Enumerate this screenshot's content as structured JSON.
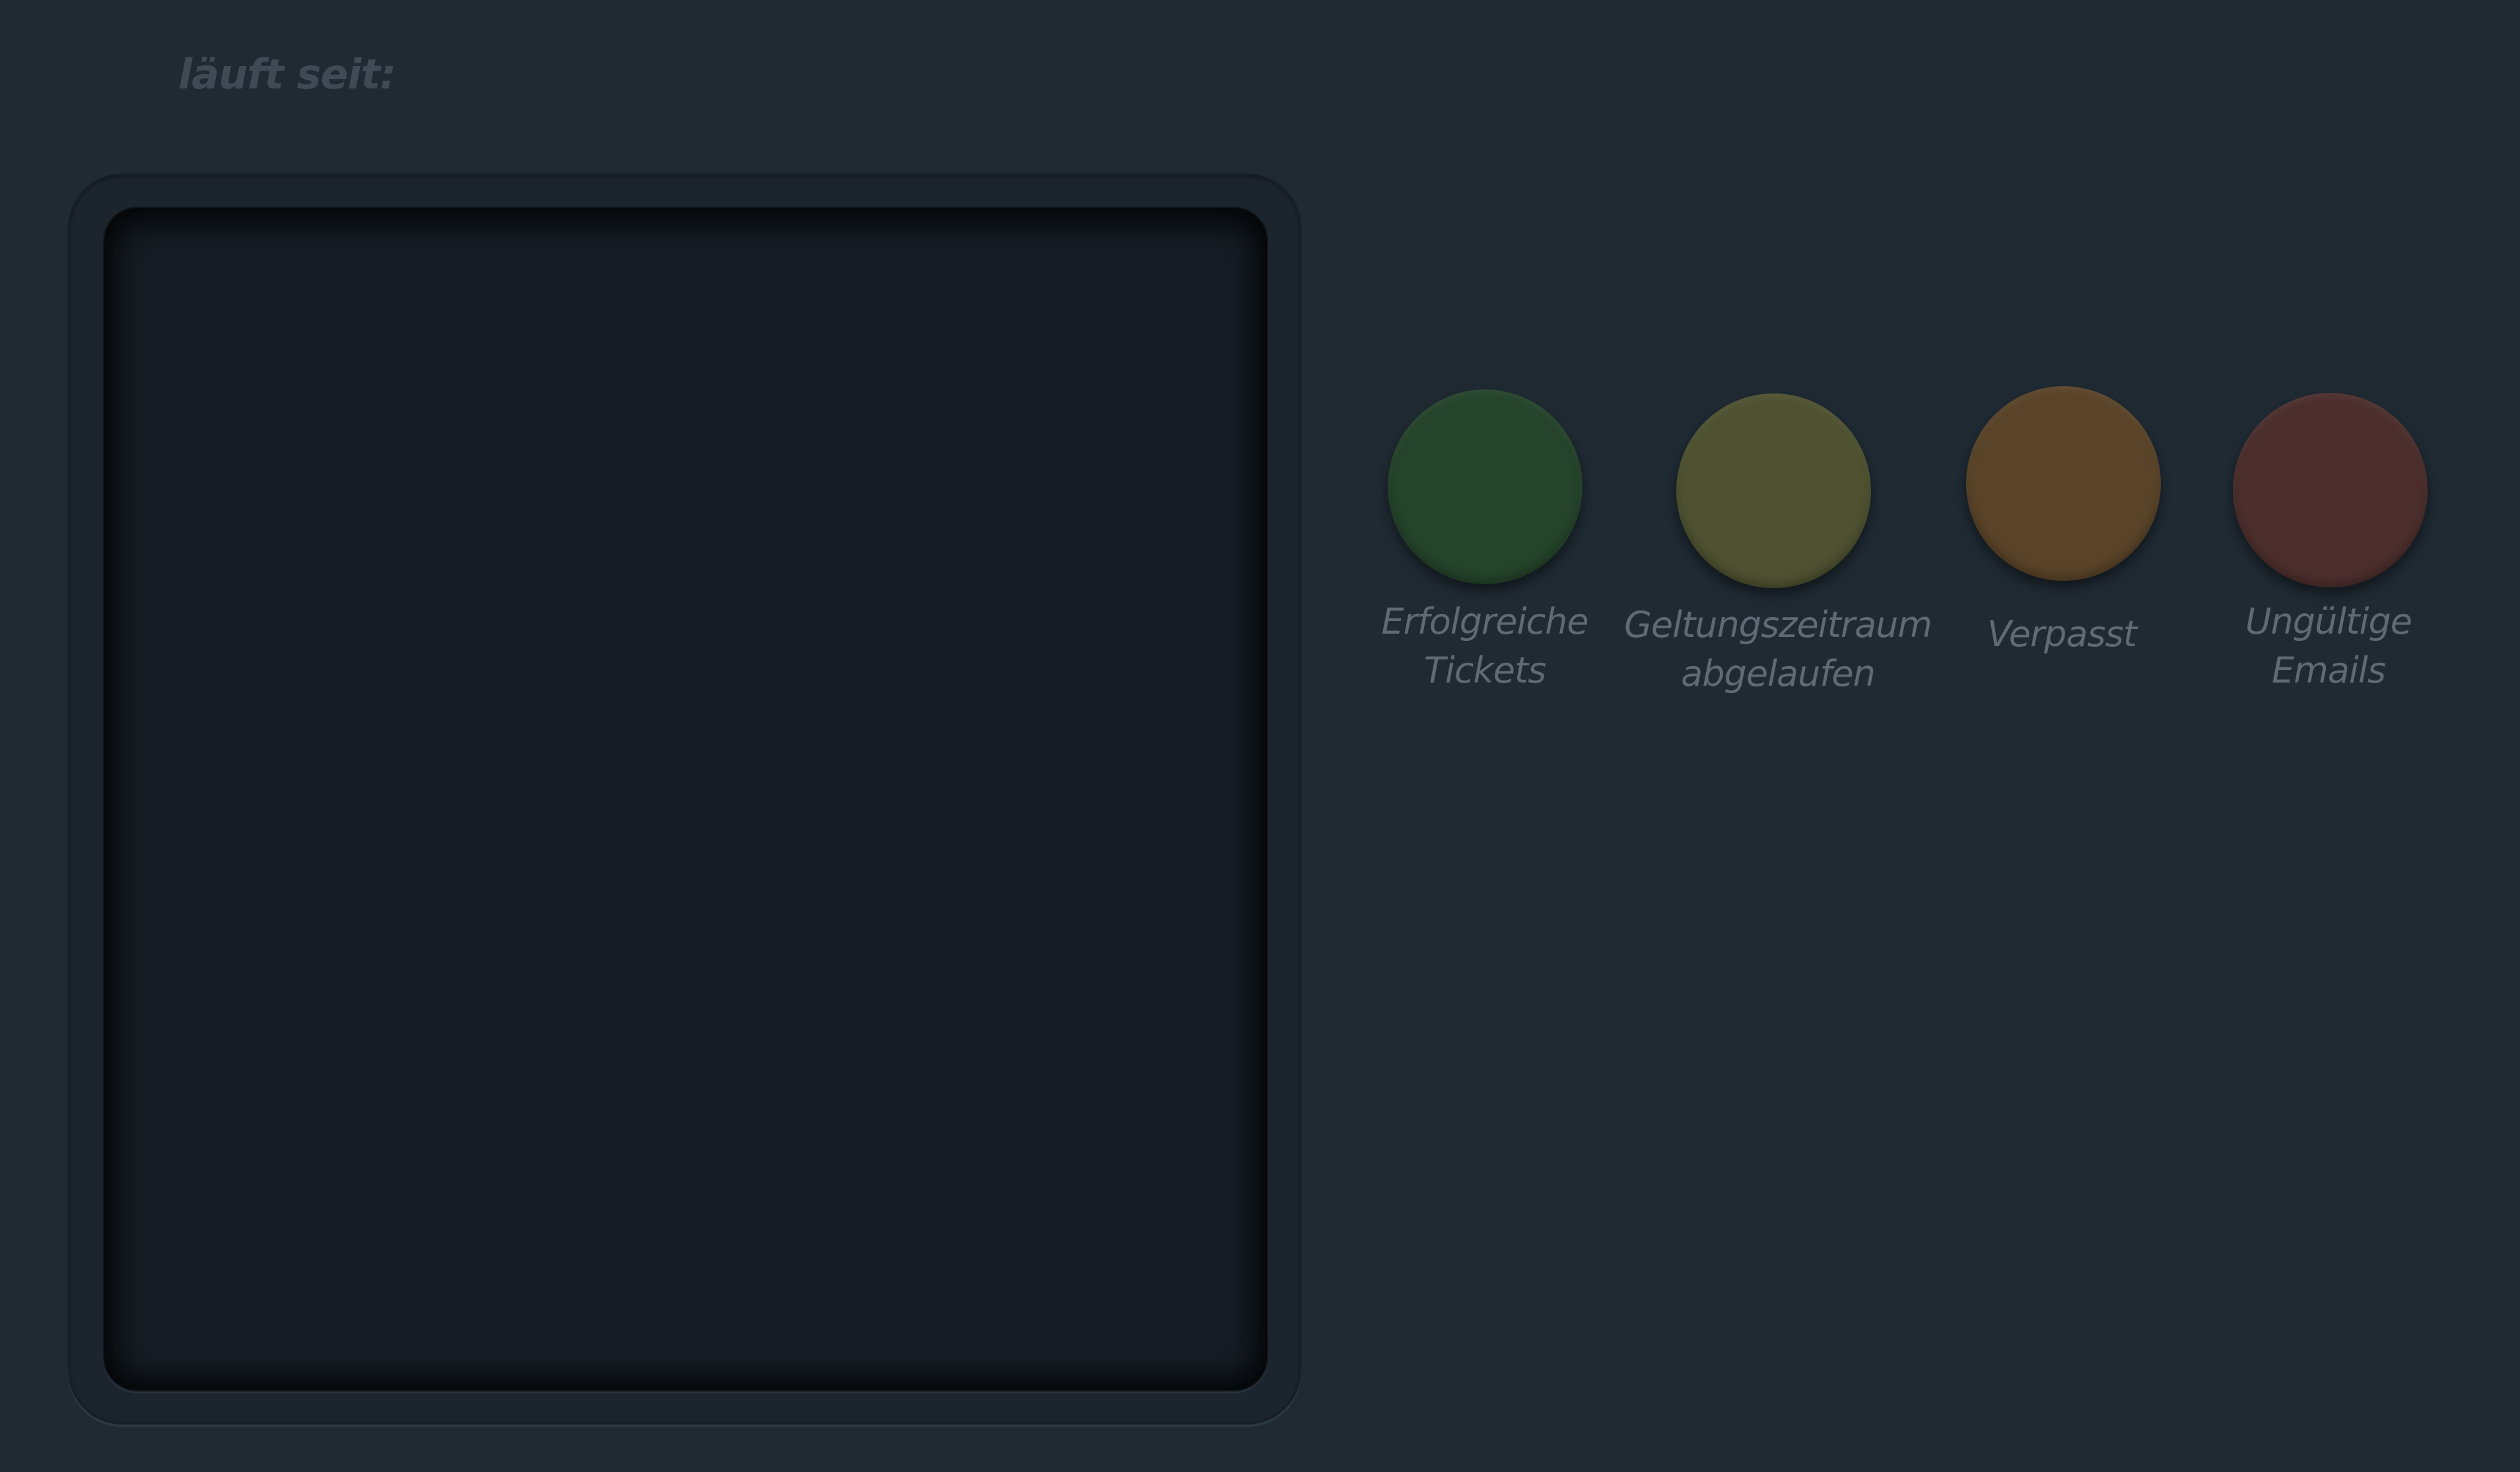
{
  "header": {
    "runtime_label": "läuft seit:"
  },
  "legend": {
    "items": [
      {
        "line1": "Erfolgreiche",
        "line2": "Tickets",
        "color": "#25442b"
      },
      {
        "line1": "Geltungszeitraum",
        "line2": "abgelaufen",
        "color": "#4f5231"
      },
      {
        "line1": "Verpasst",
        "line2": "",
        "color": "#5a4429"
      },
      {
        "line1": "Ungültige",
        "line2": "Emails",
        "color": "#4c2f2d"
      }
    ]
  }
}
